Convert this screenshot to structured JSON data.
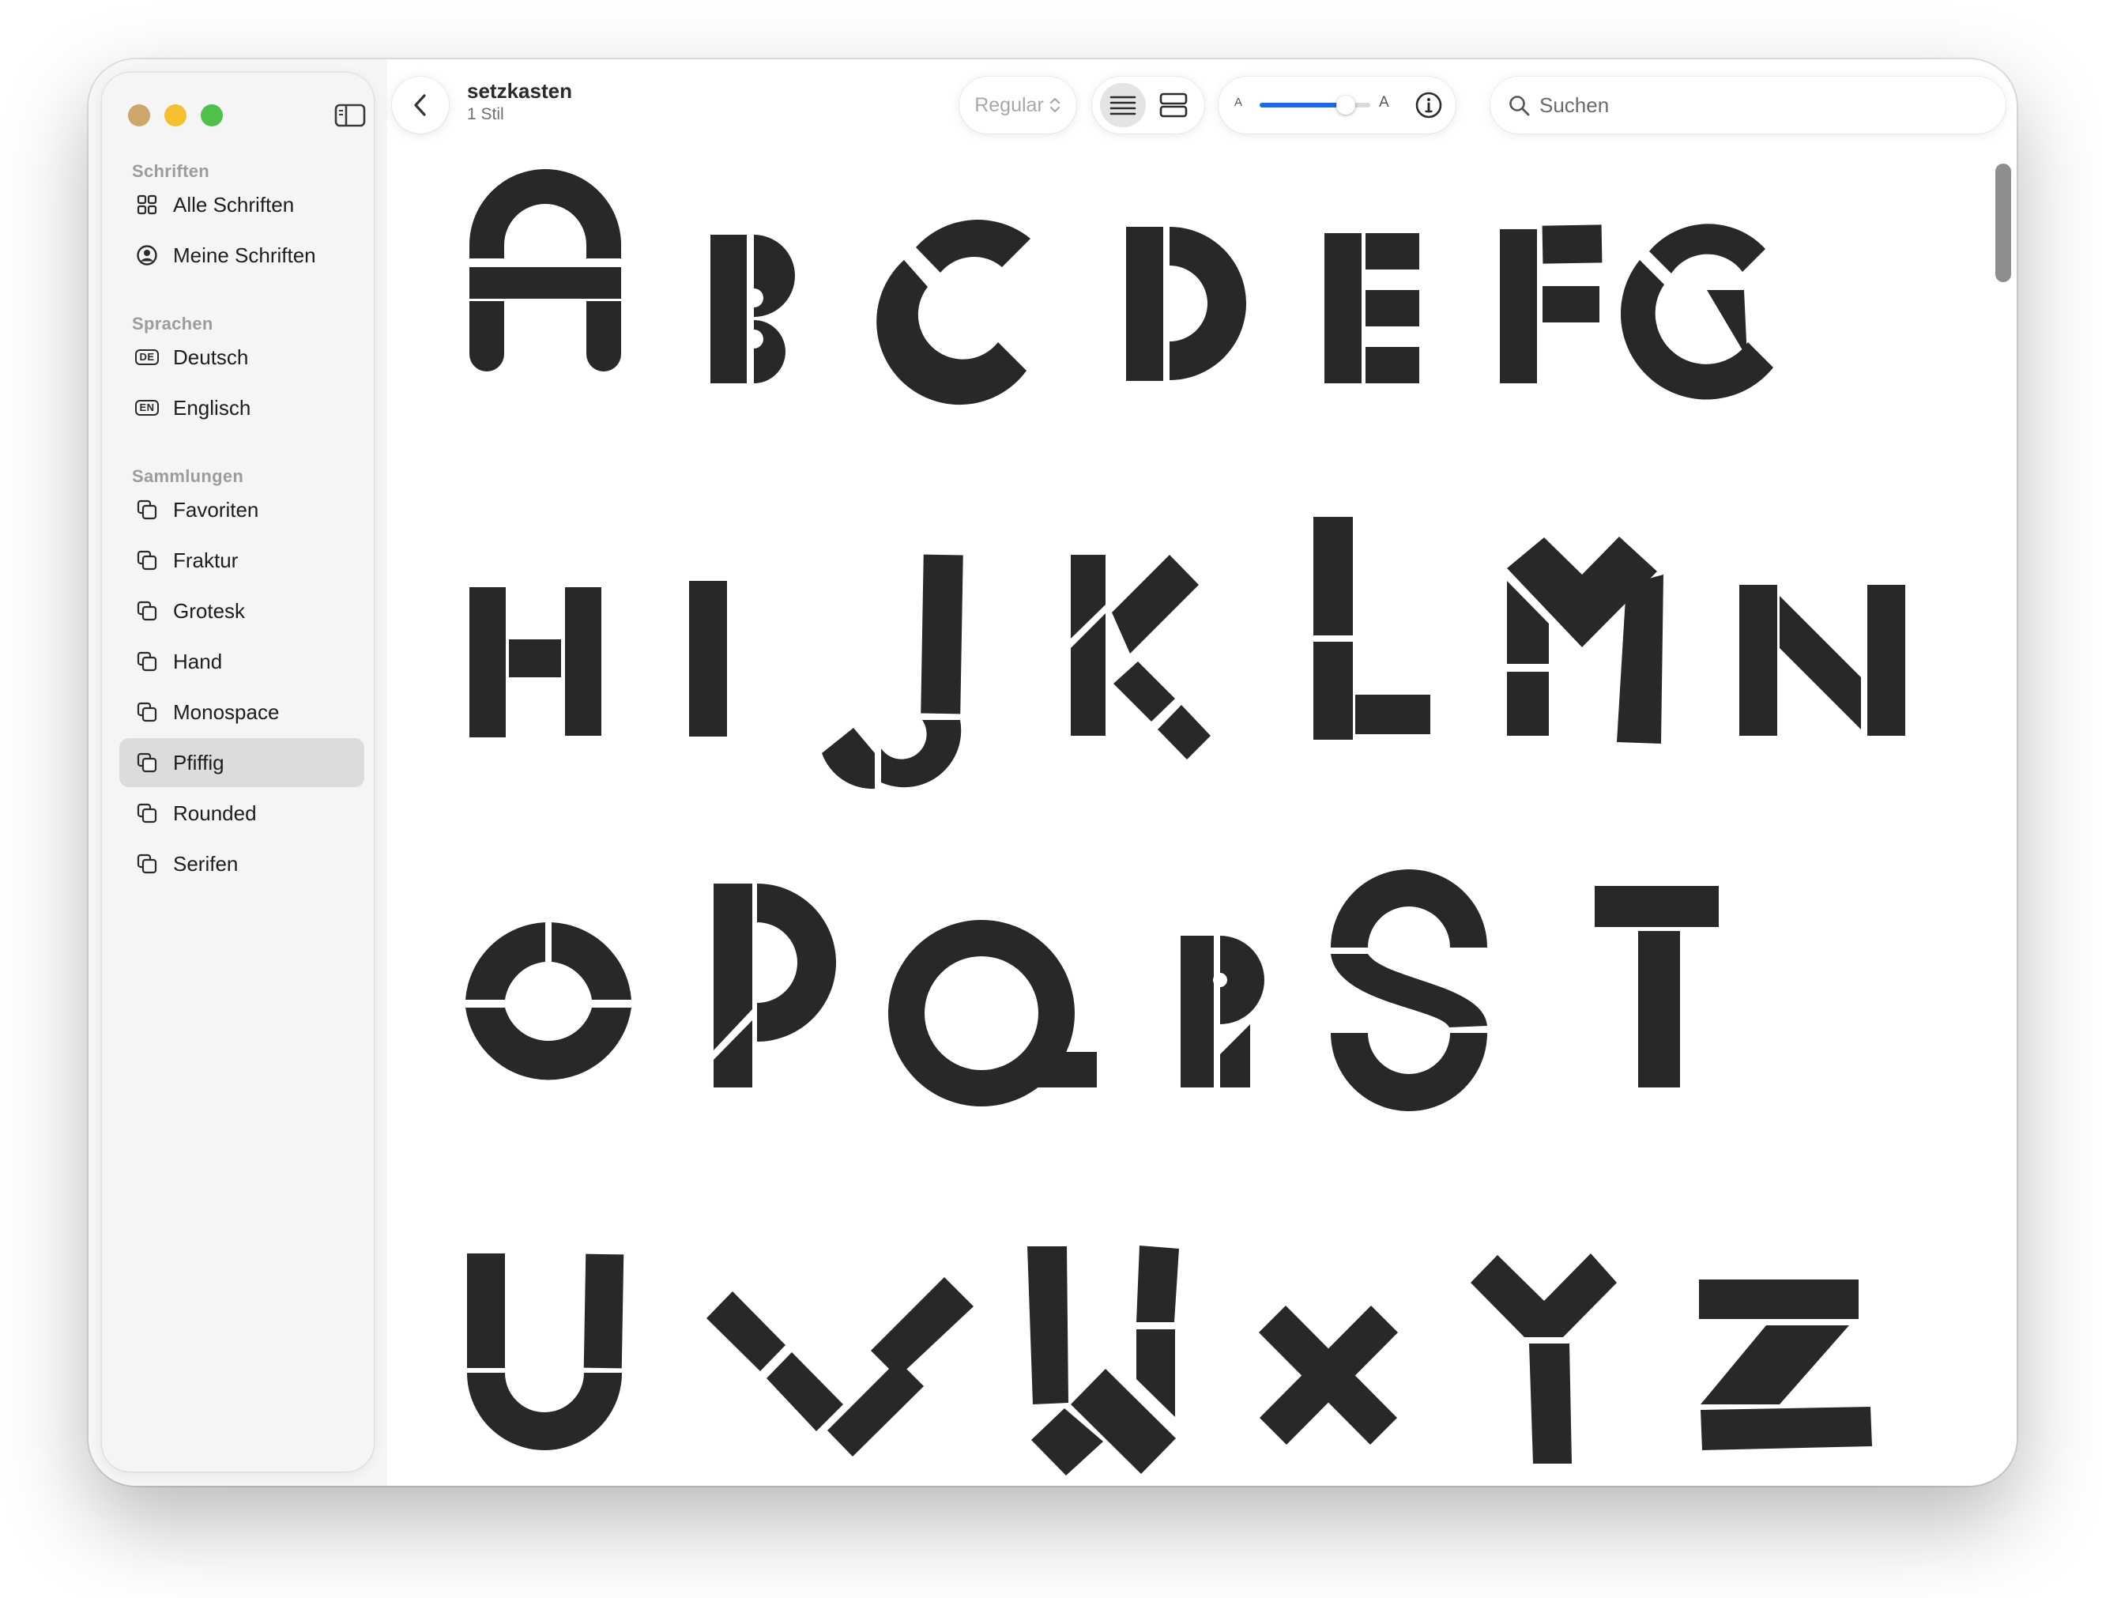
{
  "window": {
    "traffic_colors": [
      "#cda66b",
      "#f5bf2f",
      "#4cc24b"
    ]
  },
  "sidebar": {
    "sections": [
      {
        "title": "Schriften",
        "items": [
          {
            "label": "Alle Schriften",
            "icon": "grid-icon"
          },
          {
            "label": "Meine Schriften",
            "icon": "person-circle-icon"
          }
        ]
      },
      {
        "title": "Sprachen",
        "items": [
          {
            "label": "Deutsch",
            "icon": "language-badge-icon",
            "badge": "DE"
          },
          {
            "label": "Englisch",
            "icon": "language-badge-icon",
            "badge": "EN"
          }
        ]
      },
      {
        "title": "Sammlungen",
        "items": [
          {
            "label": "Favoriten",
            "icon": "collection-icon"
          },
          {
            "label": "Fraktur",
            "icon": "collection-icon"
          },
          {
            "label": "Grotesk",
            "icon": "collection-icon"
          },
          {
            "label": "Hand",
            "icon": "collection-icon"
          },
          {
            "label": "Monospace",
            "icon": "collection-icon"
          },
          {
            "label": "Pfiffig",
            "icon": "collection-icon",
            "selected": true
          },
          {
            "label": "Rounded",
            "icon": "collection-icon"
          },
          {
            "label": "Serifen",
            "icon": "collection-icon"
          }
        ]
      }
    ]
  },
  "toolbar": {
    "title": "setzkasten",
    "subtitle": "1 Stil",
    "style_select": "Regular",
    "view_mode": "list",
    "size_small_label": "A",
    "size_large_label": "A",
    "size_level": 0.78,
    "search_placeholder": "Suchen",
    "accent_color": "#1a6bf0"
  },
  "preview": {
    "glyph_color": "#282828",
    "rows": [
      "ABCDEFG",
      "HIJKLMN",
      "OPQRST",
      "UVWXYZ"
    ]
  }
}
